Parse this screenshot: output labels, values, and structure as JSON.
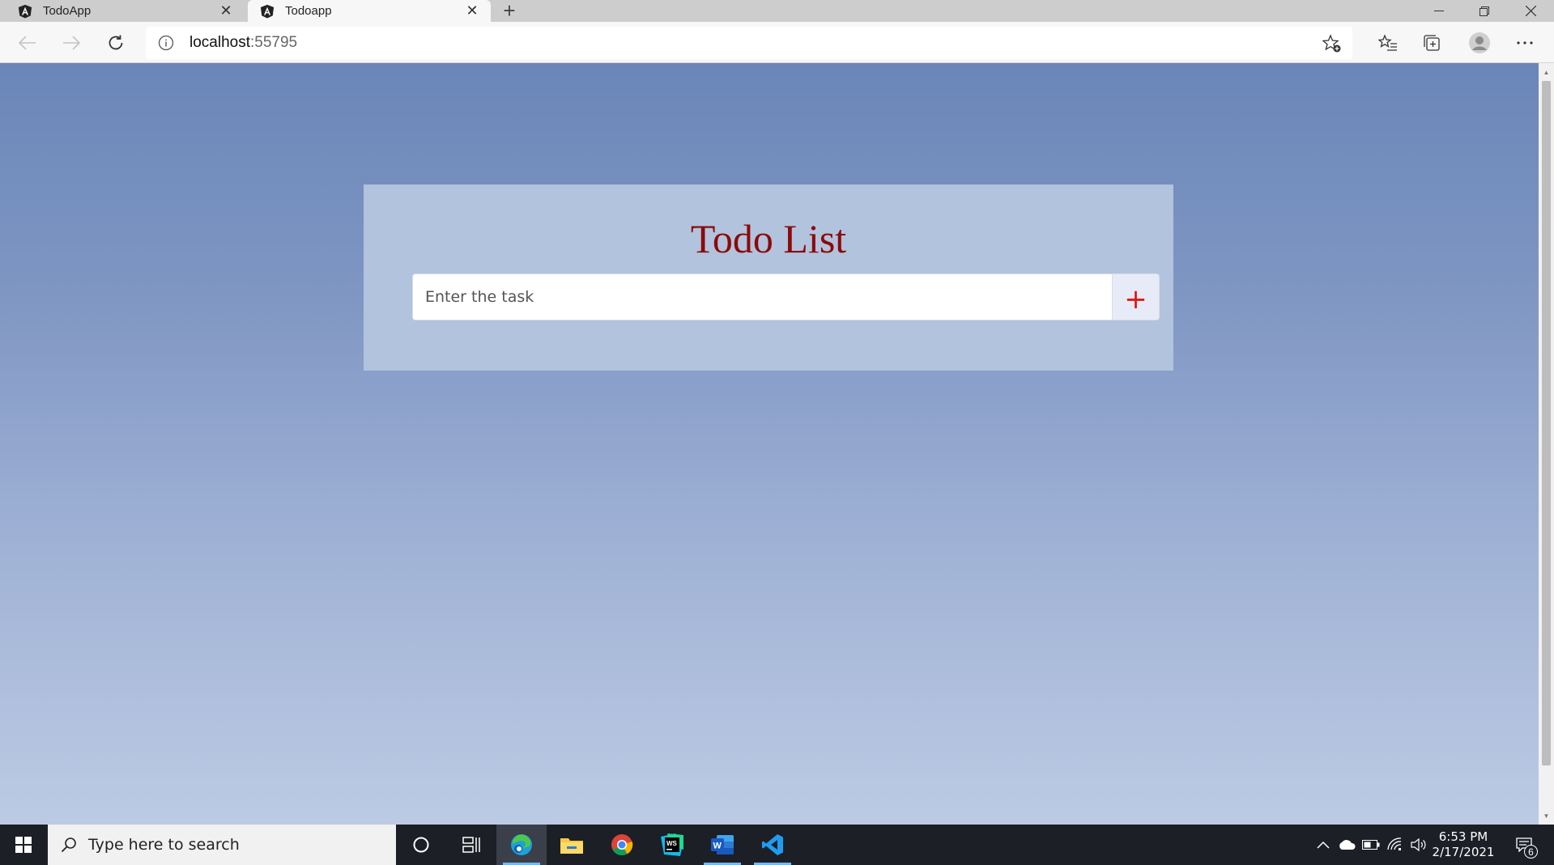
{
  "browser": {
    "tabs": [
      {
        "title": "TodoApp",
        "icon": "angular-icon",
        "active": false
      },
      {
        "title": "Todoapp",
        "icon": "angular-icon",
        "active": true
      }
    ],
    "address": {
      "host": "localhost",
      "port": ":55795"
    }
  },
  "page": {
    "title": "Todo List",
    "task_input": {
      "placeholder": "Enter the task",
      "value": ""
    },
    "add_button_label": "+",
    "colors": {
      "title": "#8b0a0a",
      "card": "#b1c3dd",
      "add_icon": "#e01818",
      "background_top": "#6a86b8",
      "background_bottom": "#bccbe4"
    }
  },
  "taskbar": {
    "search_placeholder": "Type here to search",
    "apps": [
      "cortana-icon",
      "task-view-icon",
      "edge-icon",
      "file-explorer-icon",
      "chrome-icon",
      "webstorm-icon",
      "word-icon",
      "vscode-icon"
    ],
    "clock": {
      "time": "6:53 PM",
      "date": "2/17/2021"
    },
    "notification_count": "6"
  }
}
